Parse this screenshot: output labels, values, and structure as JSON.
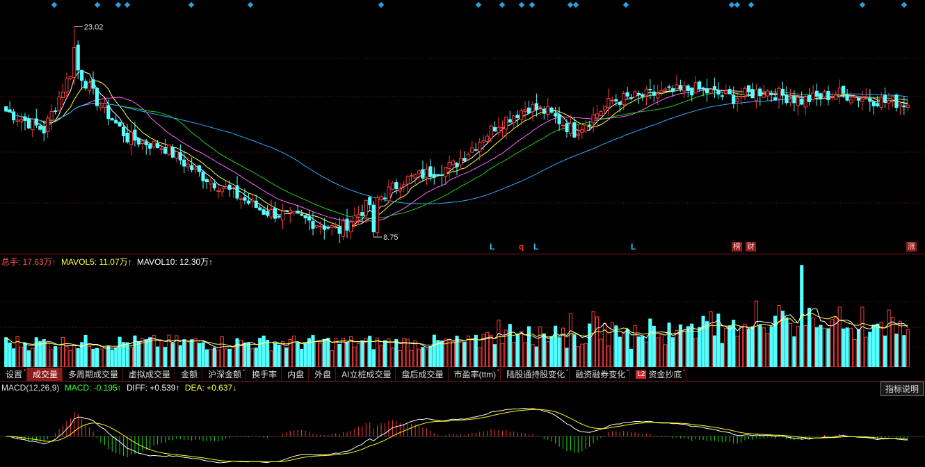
{
  "price_panel": {
    "high_label": "23.02",
    "low_label": "8.75"
  },
  "signals": [
    {
      "text": "L",
      "color": "#33ccff"
    },
    {
      "text": "q",
      "color": "#ff3333"
    },
    {
      "text": "L",
      "color": "#33ccff"
    },
    {
      "text": "L",
      "color": "#33ccff"
    }
  ],
  "badges": [
    "榜",
    "财",
    "涨"
  ],
  "volume_legend": {
    "total_label": "总手: 17.63万↑",
    "mavol5_label": "MAVOL5: 11.07万↑",
    "mavol10_label": "MAVOL10: 12.30万↑"
  },
  "tabs": [
    {
      "label": "设置",
      "dot": true
    },
    {
      "label": "成交量",
      "dot": false,
      "active": true
    },
    {
      "label": "多周期成交量",
      "dot": false
    },
    {
      "label": "虚拟成交量",
      "dot": false
    },
    {
      "label": "金额",
      "dot": false
    },
    {
      "label": "沪深金额",
      "dot": true
    },
    {
      "label": "换手率",
      "dot": false
    },
    {
      "label": "内盘",
      "dot": false
    },
    {
      "label": "外盘",
      "dot": false
    },
    {
      "label": "AI立桩成交量",
      "dot": false
    },
    {
      "label": "盘后成交量",
      "dot": false
    },
    {
      "label": "市盈率(ttm)",
      "dot": true
    },
    {
      "label": "陆股通持股变化",
      "dot": true
    },
    {
      "label": "融资融券变化",
      "dot": true
    },
    {
      "label": "资金抄底",
      "dot": true,
      "badge": "L2"
    }
  ],
  "macd_legend": {
    "name": "MACD(12,26,9)",
    "macd_label": "MACD: -0.195↑",
    "diff_label": "DIFF: +0.539↑",
    "dea_label": "DEA: +0.637↓"
  },
  "explain_button": "指标说明",
  "colors": {
    "up": "#ff3b3b",
    "down": "#54ffff",
    "ma5": "#ffffff",
    "ma10": "#ffff44",
    "ma20": "#ff66ff",
    "ma30": "#22cc22",
    "ma60": "#33aaff",
    "diff": "#ffffff",
    "dea": "#ffff00",
    "grid": "#8a1b1b"
  },
  "chart_data": {
    "type": "candlestick",
    "price_range": [
      8.0,
      24.0
    ],
    "high": 23.02,
    "low": 8.75,
    "close_anchors": [
      [
        0,
        17.3
      ],
      [
        10,
        16.0
      ],
      [
        18,
        20.5
      ],
      [
        24,
        18.0
      ],
      [
        32,
        15.5
      ],
      [
        42,
        14.8
      ],
      [
        50,
        13.2
      ],
      [
        58,
        12.0
      ],
      [
        68,
        10.5
      ],
      [
        78,
        10.0
      ],
      [
        88,
        9.2
      ],
      [
        95,
        10.8
      ],
      [
        105,
        12.6
      ],
      [
        118,
        13.6
      ],
      [
        130,
        16.5
      ],
      [
        138,
        17.6
      ],
      [
        143,
        17.2
      ],
      [
        150,
        15.9
      ],
      [
        160,
        18.0
      ],
      [
        170,
        18.4
      ],
      [
        182,
        18.8
      ],
      [
        192,
        18.2
      ],
      [
        200,
        18.7
      ],
      [
        210,
        18.0
      ],
      [
        220,
        18.5
      ],
      [
        228,
        18.1
      ],
      [
        238,
        17.8
      ]
    ],
    "candle_count": 239,
    "volume_range": [
      0,
      40
    ],
    "macd_range": [
      -1.6,
      1.6
    ]
  }
}
